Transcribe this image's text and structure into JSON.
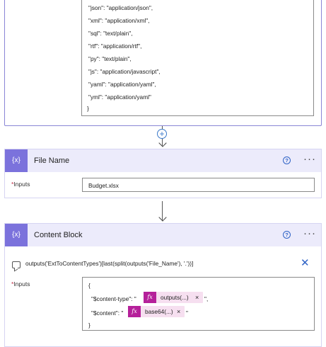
{
  "top_block": {
    "json_lines": [
      "\"json\": \"application/json\",",
      "\"xml\": \"application/xml\",",
      "\"sql\": \"text/plain\",",
      "\"rtf\": \"application/rtf\",",
      "\"py\": \"text/plain\",",
      "\"js\": \"application/javascript\",",
      "\"yaml\": \"application/yaml\",",
      "\"yml\": \"application/yaml\"",
      "}"
    ]
  },
  "connector": {
    "plus_label": "+"
  },
  "file_name_card": {
    "title": "File Name",
    "icon_text": "{x}",
    "help": "?",
    "more": "···",
    "inputs_label": "Inputs",
    "required_mark": "*",
    "input_value": "Budget.xlsx"
  },
  "content_block_card": {
    "title": "Content Block",
    "icon_text": "{x}",
    "help": "?",
    "more": "···",
    "expression": "outputs('ExtToContentTypes')[last(split(outputs('File_Name'), '.'))]",
    "close": "✕",
    "inputs_label": "Inputs",
    "required_mark": "*",
    "body": {
      "open_brace": "{",
      "line1_prefix": "\"$content-type\": \"",
      "line1_suffix": "\",",
      "line2_prefix": "\"$content\": \"",
      "line2_suffix": "\"",
      "close_brace": "}",
      "token_fx": "fx",
      "token1": "outputs(...)",
      "token2": "base64(...)",
      "token_remove": "×"
    }
  },
  "colors": {
    "accent_purple": "#7b72dc",
    "header_bg": "#ecebfb",
    "token_pink": "#b5209a",
    "link_blue": "#2f63c6"
  }
}
